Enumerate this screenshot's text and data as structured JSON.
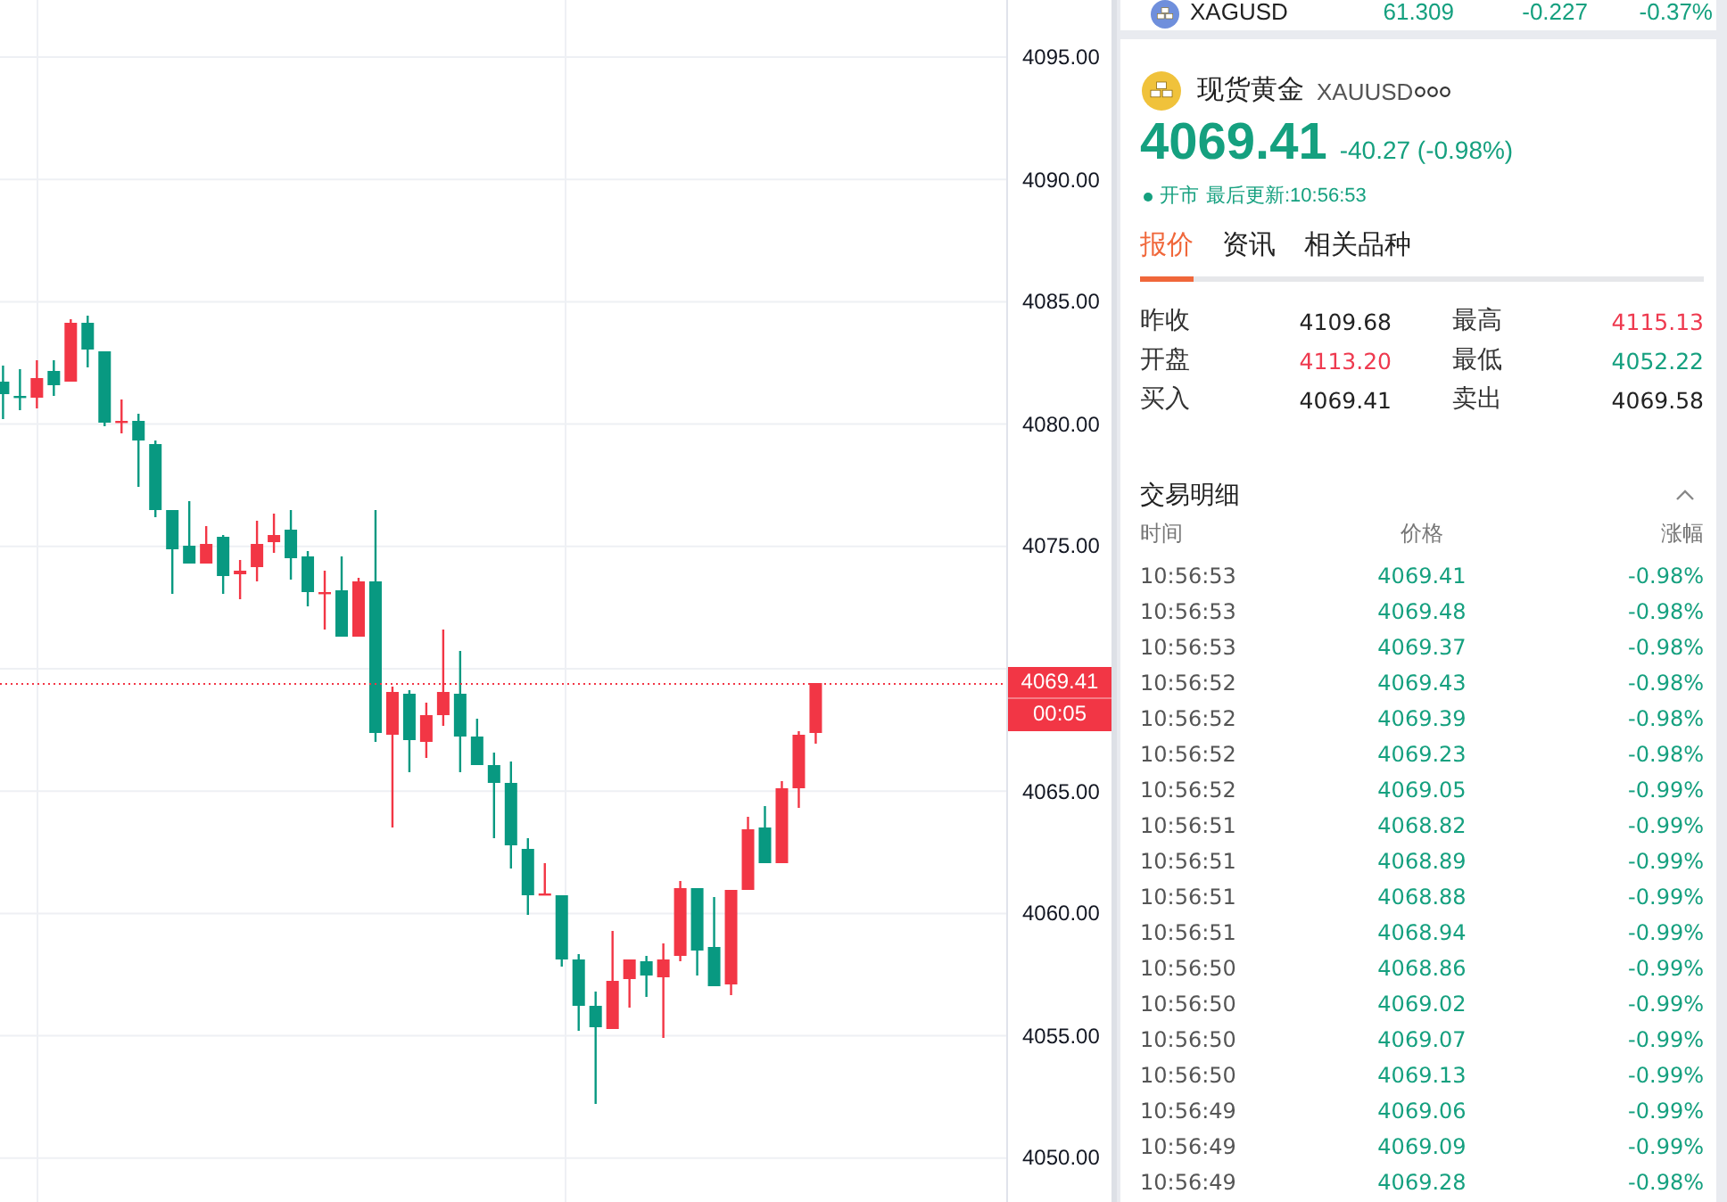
{
  "chart": {
    "price_axis": [
      "4095.00",
      "4090.00",
      "4085.00",
      "4080.00",
      "4075.00",
      "4065.00",
      "4060.00",
      "4055.00",
      "4050.00"
    ],
    "last_price": {
      "price": "4069.41",
      "countdown": "00:05"
    }
  },
  "watchlist_row": {
    "symbol": "XAGUSD",
    "price": "61.309",
    "change": "-0.227",
    "change_percent": "-0.37%"
  },
  "quote": {
    "name": "现货黄金",
    "symbol": "XAUUSD",
    "price": "4069.41",
    "change": "-40.27 (-0.98%)",
    "market_open": true,
    "market_status": "开市",
    "last_update": "最后更新:10:56:53"
  },
  "tabs": [
    {
      "label": "报价",
      "selected": true
    },
    {
      "label": "资讯",
      "selected": false
    },
    {
      "label": "相关品种",
      "selected": false
    }
  ],
  "stats": [
    {
      "label": "昨收",
      "value": "4109.68",
      "color": "#222222"
    },
    {
      "label": "最高",
      "value": "4115.13",
      "color": "#ee3a4f"
    },
    {
      "label": "开盘",
      "value": "4113.20",
      "color": "#ee3a4f"
    },
    {
      "label": "最低",
      "value": "4052.22",
      "color": "#15a07f"
    },
    {
      "label": "买入",
      "value": "4069.41",
      "color": "#222222"
    },
    {
      "label": "卖出",
      "value": "4069.58",
      "color": "#222222"
    }
  ],
  "trades": {
    "title": "交易明细",
    "expanded": true,
    "columns": [
      "时间",
      "价格",
      "涨幅"
    ],
    "rows": [
      {
        "time": "10:56:53",
        "price": "4069.41",
        "change": "-0.98%"
      },
      {
        "time": "10:56:53",
        "price": "4069.48",
        "change": "-0.98%"
      },
      {
        "time": "10:56:53",
        "price": "4069.37",
        "change": "-0.98%"
      },
      {
        "time": "10:56:52",
        "price": "4069.43",
        "change": "-0.98%"
      },
      {
        "time": "10:56:52",
        "price": "4069.39",
        "change": "-0.98%"
      },
      {
        "time": "10:56:52",
        "price": "4069.23",
        "change": "-0.98%"
      },
      {
        "time": "10:56:52",
        "price": "4069.05",
        "change": "-0.99%"
      },
      {
        "time": "10:56:51",
        "price": "4068.82",
        "change": "-0.99%"
      },
      {
        "time": "10:56:51",
        "price": "4068.89",
        "change": "-0.99%"
      },
      {
        "time": "10:56:51",
        "price": "4068.88",
        "change": "-0.99%"
      },
      {
        "time": "10:56:51",
        "price": "4068.94",
        "change": "-0.99%"
      },
      {
        "time": "10:56:50",
        "price": "4068.86",
        "change": "-0.99%"
      },
      {
        "time": "10:56:50",
        "price": "4069.02",
        "change": "-0.99%"
      },
      {
        "time": "10:56:50",
        "price": "4069.07",
        "change": "-0.99%"
      },
      {
        "time": "10:56:50",
        "price": "4069.13",
        "change": "-0.99%"
      },
      {
        "time": "10:56:49",
        "price": "4069.06",
        "change": "-0.99%"
      },
      {
        "time": "10:56:49",
        "price": "4069.09",
        "change": "-0.99%"
      },
      {
        "time": "10:56:49",
        "price": "4069.28",
        "change": "-0.98%"
      }
    ]
  }
}
